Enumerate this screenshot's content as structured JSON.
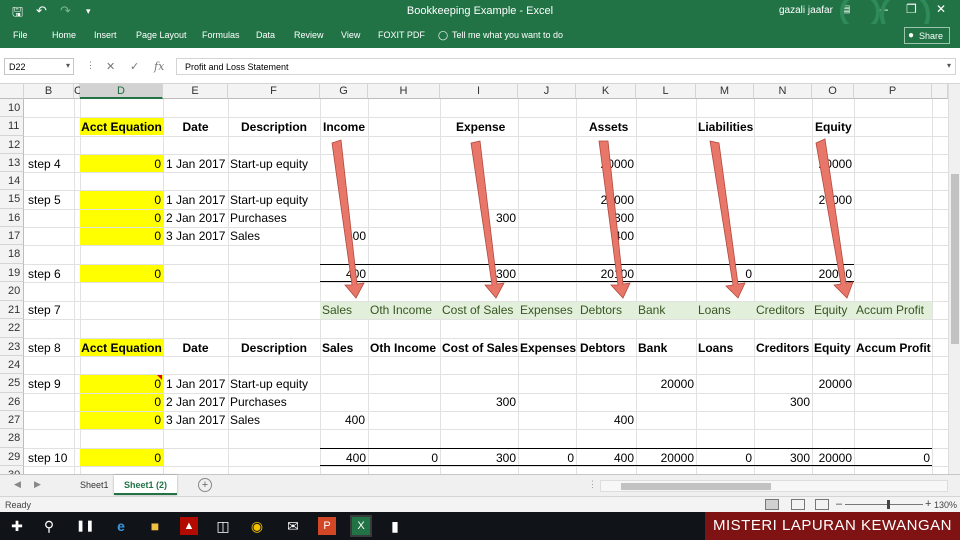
{
  "window": {
    "title": "Bookkeeping Example - Excel",
    "user": "gazali jaafar"
  },
  "ribbon_tabs": [
    "File",
    "Home",
    "Insert",
    "Page Layout",
    "Formulas",
    "Data",
    "Review",
    "View",
    "FOXIT PDF"
  ],
  "tell_me": "Tell me what you want to do",
  "share_label": "Share",
  "formula_bar": {
    "name_box": "D22",
    "fx": "fx",
    "content": "Profit and Loss Statement"
  },
  "columns": [
    "B",
    "C",
    "D",
    "E",
    "F",
    "G",
    "H",
    "I",
    "J",
    "K",
    "L",
    "M",
    "N",
    "O",
    "P"
  ],
  "rows": [
    "10",
    "11",
    "12",
    "13",
    "14",
    "15",
    "16",
    "17",
    "18",
    "19",
    "20",
    "21",
    "22",
    "23",
    "24",
    "25",
    "26",
    "27",
    "28",
    "29",
    "30"
  ],
  "sheet": {
    "r11": {
      "d": "Acct Equation",
      "e": "Date",
      "f": "Description",
      "g": "Income",
      "i": "Expense",
      "k": "Assets",
      "m": "Liabilities",
      "o": "Equity"
    },
    "r13": {
      "b": "step 4",
      "d": "0",
      "e": "1 Jan 2017",
      "f": "Start-up equity",
      "k": "20000",
      "o": "20000"
    },
    "r15": {
      "b": "step 5",
      "d": "0",
      "e": "1 Jan 2017",
      "f": "Start-up equity",
      "k": "20000",
      "o": "20000"
    },
    "r16": {
      "d": "0",
      "e": "2 Jan 2017",
      "f": "Purchases",
      "i": "300",
      "k": "300"
    },
    "r17": {
      "d": "0",
      "e": "3 Jan 2017",
      "f": "Sales",
      "g": "400",
      "k": "400"
    },
    "r19": {
      "b": "step 6",
      "d": "0",
      "g": "400",
      "i": "300",
      "k": "20100",
      "m": "0",
      "o": "20000"
    },
    "r21": {
      "b": "step 7",
      "g": "Sales",
      "h": "Oth Income",
      "i": "Cost of Sales",
      "j": "Expenses",
      "k": "Debtors",
      "l": "Bank",
      "m": "Loans",
      "n": "Creditors",
      "o": "Equity",
      "p": "Accum Profit"
    },
    "r23": {
      "b": "step 8",
      "d": "Acct Equation",
      "e": "Date",
      "f": "Description",
      "g": "Sales",
      "h": "Oth Income",
      "i": "Cost of Sales",
      "j": "Expenses",
      "k": "Debtors",
      "l": "Bank",
      "m": "Loans",
      "n": "Creditors",
      "o": "Equity",
      "p": "Accum Profit"
    },
    "r25": {
      "b": "step 9",
      "d": "0",
      "e": "1 Jan 2017",
      "f": "Start-up equity",
      "l": "20000",
      "o": "20000"
    },
    "r26": {
      "d": "0",
      "e": "2 Jan 2017",
      "f": "Purchases",
      "i": "300",
      "n": "300"
    },
    "r27": {
      "d": "0",
      "e": "3 Jan 2017",
      "f": "Sales",
      "g": "400",
      "k": "400"
    },
    "r29": {
      "b": "step 10",
      "d": "0",
      "g": "400",
      "h": "0",
      "i": "300",
      "j": "0",
      "k": "400",
      "l": "20000",
      "m": "0",
      "n": "300",
      "o": "20000",
      "p": "0"
    }
  },
  "sheet_tabs": [
    "Sheet1",
    "Sheet1 (2)"
  ],
  "active_sheet": "Sheet1 (2)",
  "status": {
    "ready": "Ready",
    "zoom": "130%"
  },
  "banner": "MISTERI LAPURAN KEWANGAN",
  "colors": {
    "excel_green": "#217346",
    "highlight_yellow": "#ffff00",
    "header_green": "#e2efda",
    "arrow": "#e8776a",
    "banner": "#7f1212"
  },
  "icons": [
    "save-icon",
    "undo-icon",
    "redo-icon",
    "customize-icon",
    "ribbon-display-icon",
    "minimize-icon",
    "restore-icon",
    "close-icon",
    "lightbulb-icon",
    "person-icon",
    "windows-start-icon",
    "search-icon",
    "task-view-icon",
    "edge-icon",
    "file-explorer-icon",
    "acrobat-icon",
    "store-icon",
    "chrome-icon",
    "mail-icon",
    "powerpoint-icon",
    "excel-icon",
    "video-editor-icon"
  ]
}
